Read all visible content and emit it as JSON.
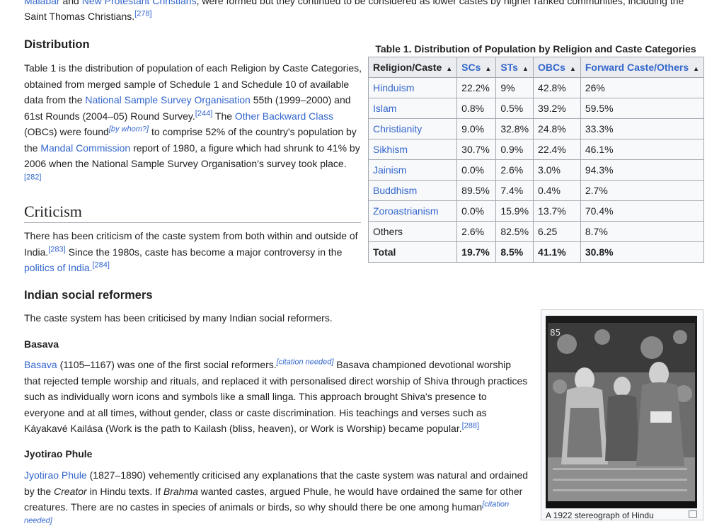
{
  "top": {
    "line1_a": "Malabar",
    "line1_b": " and ",
    "line1_link": "New Protestant Christians",
    "line1_c": ", were formed but they continued to be considered as lower castes by higher ranked communities, including the",
    "line2": "Saint Thomas Christians.",
    "line2_ref": "[278]"
  },
  "distribution": {
    "heading": "Distribution",
    "p1": "Table 1 is the distribution of population of each Religion by Caste Categories, obtained from merged sample of Schedule 1 and Schedule 10 of available data from the ",
    "link_nsso": "National Sample Survey Organisation",
    "p2": " 55th (1999–2000) and 61st Rounds (2004–05) Round Survey.",
    "ref_244": "[244]",
    "p3": " The ",
    "link_obc": "Other Backward Class",
    "p4": " (OBCs) were found",
    "note_bywhom": "[by whom?]",
    "p5": " to comprise 52% of the country's population by the ",
    "link_mandal": "Mandal Commission",
    "p6": " report of 1980, a figure which had shrunk to 41% by 2006 when the National Sample Survey Organisation's survey took place.",
    "ref_282": "[282]"
  },
  "criticism": {
    "heading": "Criticism",
    "p1": "There has been criticism of the caste system from both within and outside of India.",
    "ref_283": "[283]",
    "p2": " Since the 1980s, caste has become a major controversy in the ",
    "link_politics": "politics of India.",
    "ref_284": "[284]"
  },
  "reformers": {
    "heading": "Indian social reformers",
    "intro": "The caste system has been criticised by many Indian social reformers."
  },
  "basava": {
    "heading": "Basava",
    "link": "Basava",
    "p1": " (1105–1167) was one of the first social reformers.",
    "note_cit": "[citation needed]",
    "p2": " Basava championed devotional worship that rejected temple worship and rituals, and replaced it with personalised direct worship of Shiva through practices such as individually worn icons and symbols like a small linga. This approach brought Shiva's presence to everyone and at all times, without gender, class or caste discrimination. His teachings and verses such as Káyakavé Kailása (Work is the path to Kailash (bliss, heaven), or Work is Worship) became popular.",
    "ref_288": "[288]"
  },
  "phule": {
    "heading": "Jyotirao Phule",
    "link": "Jyotirao Phule",
    "p1": " (1827–1890) vehemently criticised any explanations that the caste system was natural and ordained by the ",
    "em_creator": "Creator",
    "p2": " in Hindu texts. If ",
    "em_brahma": "Brahma",
    "p3": " wanted castes, argued Phule, he would have ordained the same for other creatures. There are no castes in species of animals or birds, so why should there be one among human",
    "note_cit": "[citation needed]"
  },
  "table": {
    "caption": "Table 1. Distribution of Population by Religion and Caste Categories",
    "sort_icon": "sort-arrows-icon",
    "headers": [
      "Religion/Caste",
      "SCs",
      "STs",
      "OBCs",
      "Forward Caste/Others"
    ],
    "rows": [
      {
        "religion": "Hinduism",
        "scs": "22.2%",
        "sts": "9%",
        "obcs": "42.8%",
        "fwd": "26%"
      },
      {
        "religion": "Islam",
        "scs": "0.8%",
        "sts": "0.5%",
        "obcs": "39.2%",
        "fwd": "59.5%"
      },
      {
        "religion": "Christianity",
        "scs": "9.0%",
        "sts": "32.8%",
        "obcs": "24.8%",
        "fwd": "33.3%"
      },
      {
        "religion": "Sikhism",
        "scs": "30.7%",
        "sts": "0.9%",
        "obcs": "22.4%",
        "fwd": "46.1%"
      },
      {
        "religion": "Jainism",
        "scs": "0.0%",
        "sts": "2.6%",
        "obcs": "3.0%",
        "fwd": "94.3%"
      },
      {
        "religion": "Buddhism",
        "scs": "89.5%",
        "sts": "7.4%",
        "obcs": "0.4%",
        "fwd": "2.7%"
      },
      {
        "religion": "Zoroastrianism",
        "scs": "0.0%",
        "sts": "15.9%",
        "obcs": "13.7%",
        "fwd": "70.4%"
      },
      {
        "religion": "Others",
        "scs": "2.6%",
        "sts": "82.5%",
        "obcs": "6.25",
        "fwd": "8.7%"
      }
    ],
    "total": {
      "religion": "Total",
      "scs": "19.7%",
      "sts": "8.5%",
      "obcs": "41.1%",
      "fwd": "30.8%"
    }
  },
  "image": {
    "caption": "A 1922 stereograph of Hindu",
    "photo_number": "85",
    "expand_icon": "enlarge-icon"
  }
}
